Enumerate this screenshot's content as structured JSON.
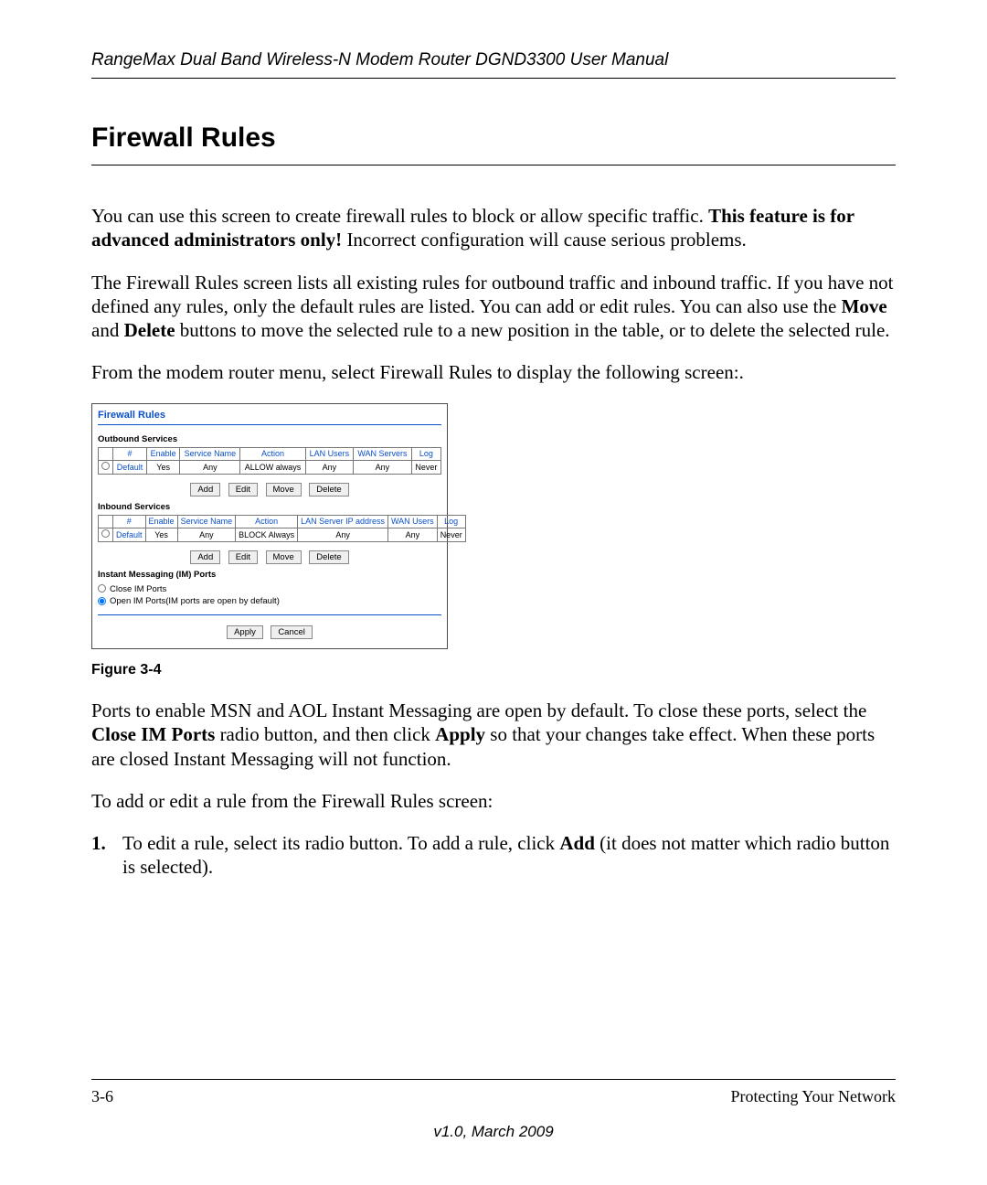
{
  "page": {
    "running_head": "RangeMax Dual Band Wireless-N Modem Router DGND3300 User Manual",
    "section_title": "Firewall Rules",
    "para1_pre": "You can use this screen to create firewall rules to block or allow specific traffic. ",
    "para1_bold": "This feature is for advanced administrators only!",
    "para1_post": " Incorrect configuration will cause serious problems.",
    "para2_a": "The Firewall Rules screen lists all existing rules for outbound traffic and inbound traffic. If you have not defined any rules, only the default rules are listed. You can add or edit rules. You can also use the ",
    "para2_move": "Move",
    "para2_b": " and ",
    "para2_delete": "Delete",
    "para2_c": " buttons to move the selected rule to a new position in the table, or to delete the selected rule.",
    "para3": "From the modem router menu, select Firewall Rules to display the following screen:.",
    "figure_caption": "Figure 3-4",
    "para4_a": "Ports to enable MSN and AOL Instant Messaging are open by default. To close these ports, select the ",
    "para4_close": "Close IM Ports",
    "para4_b": " radio button, and then click ",
    "para4_apply": "Apply",
    "para4_c": " so that your changes take effect. When these ports are closed Instant Messaging will not function.",
    "para5": "To add or edit a rule from the Firewall Rules screen:",
    "step1_num": "1.",
    "step1_a": "To edit a rule, select its radio button. To add a rule, click ",
    "step1_add": "Add",
    "step1_b": " (it does not matter which radio button is selected).",
    "footer_left": "3-6",
    "footer_right": "Protecting Your Network",
    "footer_version": "v1.0, March 2009"
  },
  "screenshot": {
    "title": "Firewall Rules",
    "outbound": {
      "heading": "Outbound Services",
      "headers": [
        "",
        "#",
        "Enable",
        "Service Name",
        "Action",
        "LAN Users",
        "WAN Servers",
        "Log"
      ],
      "row": [
        "Default",
        "Yes",
        "Any",
        "ALLOW always",
        "Any",
        "Any",
        "Never"
      ]
    },
    "inbound": {
      "heading": "Inbound Services",
      "headers": [
        "",
        "#",
        "Enable",
        "Service Name",
        "Action",
        "LAN Server IP address",
        "WAN Users",
        "Log"
      ],
      "row": [
        "Default",
        "Yes",
        "Any",
        "BLOCK Always",
        "Any",
        "Any",
        "Never"
      ]
    },
    "buttons": {
      "add": "Add",
      "edit": "Edit",
      "move": "Move",
      "delete": "Delete"
    },
    "im": {
      "heading": "Instant Messaging (IM) Ports",
      "close": "Close IM Ports",
      "open": "Open IM Ports(IM ports are open by default)"
    },
    "apply": "Apply",
    "cancel": "Cancel"
  }
}
